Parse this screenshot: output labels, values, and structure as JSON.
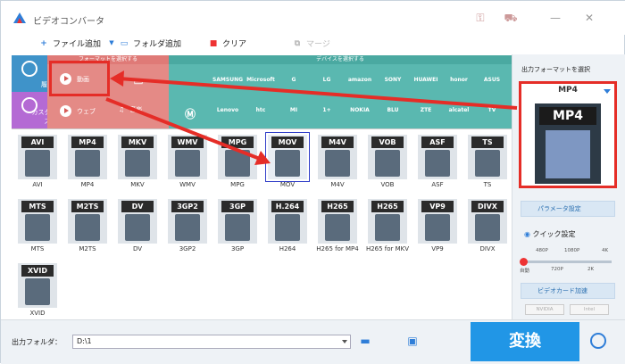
{
  "window": {
    "title": "ビデオコンバータ"
  },
  "toolbar": {
    "add_file": "ファイル追加",
    "add_folder": "フォルダ追加",
    "clear": "クリア",
    "merge": "マージ"
  },
  "categories": {
    "history": "履歴",
    "customize": "カスタマイズ",
    "video_header": "フォーマットを選択する",
    "video": "動画",
    "web": "ウェブ",
    "audio": "音楽",
    "device_header": "デバイスを選択する",
    "brands_row1": [
      "SAMSUNG",
      "Microsoft",
      "G",
      "LG",
      "amazon",
      "SONY",
      "HUAWEI",
      "honor",
      "ASUS"
    ],
    "brands_row2": [
      "Lenovo",
      "htc",
      "MI",
      "1+",
      "NOKIA",
      "BLU",
      "ZTE",
      "alcatel",
      "TV"
    ]
  },
  "formats_row1": [
    {
      "badge": "AVI",
      "name": "AVI"
    },
    {
      "badge": "MP4",
      "name": "MP4"
    },
    {
      "badge": "MKV",
      "name": "MKV"
    },
    {
      "badge": "WMV",
      "name": "WMV"
    },
    {
      "badge": "MPG",
      "name": "MPG"
    },
    {
      "badge": "MOV",
      "name": "MOV"
    },
    {
      "badge": "M4V",
      "name": "M4V"
    },
    {
      "badge": "VOB",
      "name": "VOB"
    },
    {
      "badge": "ASF",
      "name": "ASF"
    },
    {
      "badge": "TS",
      "name": "TS"
    }
  ],
  "formats_row2": [
    {
      "badge": "MTS",
      "name": "MTS"
    },
    {
      "badge": "M2TS",
      "name": "M2TS"
    },
    {
      "badge": "DV",
      "name": "DV"
    },
    {
      "badge": "3GP2",
      "name": "3GP2"
    },
    {
      "badge": "3GP",
      "name": "3GP"
    },
    {
      "badge": "H.264",
      "name": "H264"
    },
    {
      "badge": "H265",
      "name": "H265 for MP4"
    },
    {
      "badge": "H265",
      "name": "H265 for MKV"
    },
    {
      "badge": "VP9",
      "name": "VP9"
    },
    {
      "badge": "DIVX",
      "name": "DIVX"
    }
  ],
  "formats_row3": [
    {
      "badge": "XVID",
      "name": "XVID"
    }
  ],
  "right_panel": {
    "title": "出力フォーマットを選択",
    "selected_format": "MP4",
    "params_button": "パラメータ設定",
    "quick_label": "クイック設定",
    "ticks_top": [
      "480P",
      "1080P",
      "4K"
    ],
    "ticks_bottom": [
      "自動",
      "720P",
      "2K"
    ],
    "gpu_button": "ビデオカード加速",
    "gpu_vendors": [
      "NVIDIA",
      "Intel"
    ]
  },
  "bottom": {
    "output_label": "出力フォルダ：",
    "output_path": "D:\\1",
    "convert": "変換"
  },
  "colors": {
    "accent": "#2196e6",
    "annotation_red": "#e52d27",
    "video_zone": "#e48a86",
    "device_zone": "#5ab8b0",
    "history_blue": "#3f93c9",
    "custom_purple": "#b46ad4"
  }
}
